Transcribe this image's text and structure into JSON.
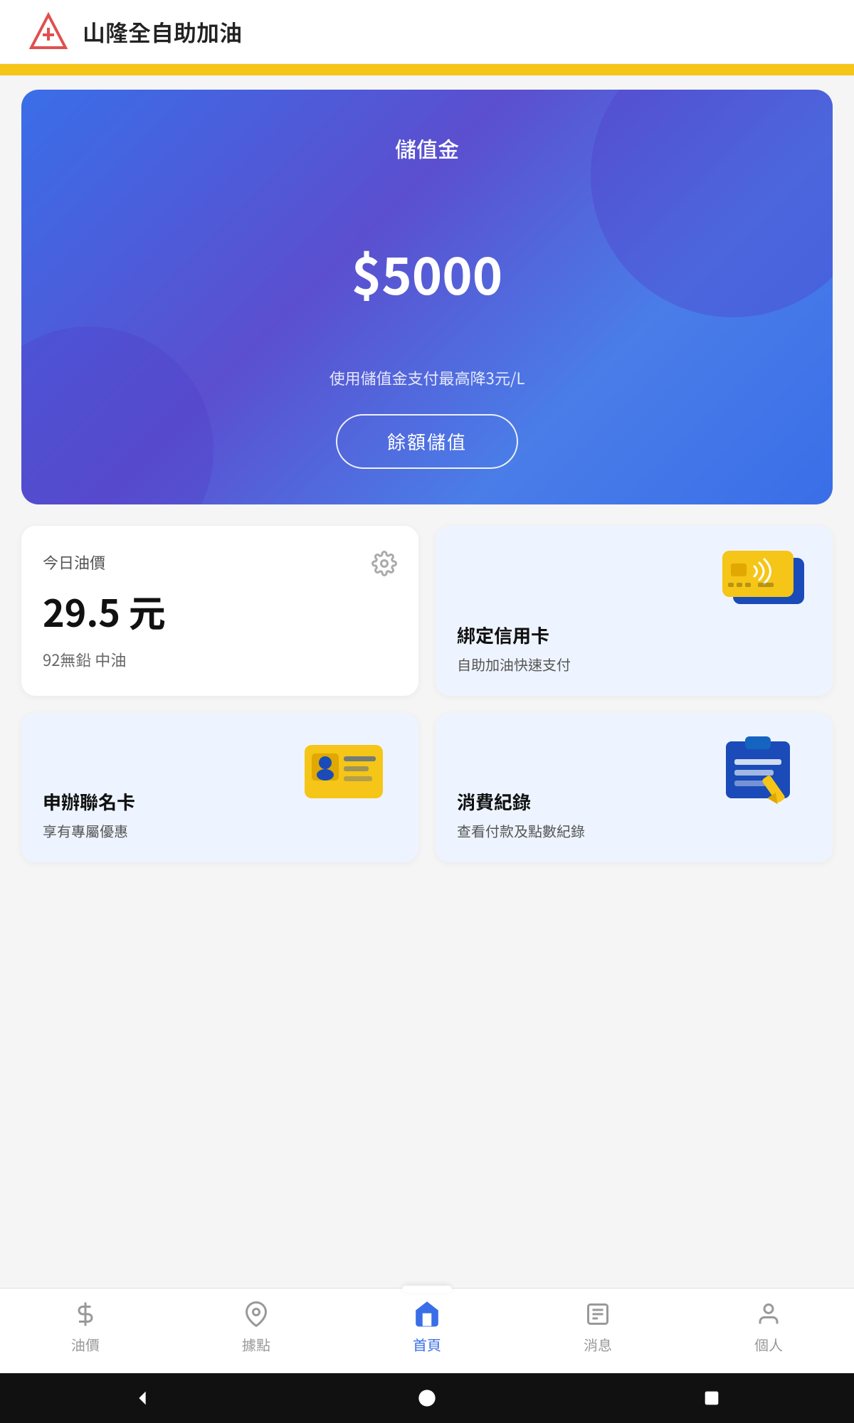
{
  "header": {
    "title": "山隆全自助加油"
  },
  "balance_card": {
    "label": "儲值金",
    "amount": "$5000",
    "hint": "使用儲值金支付最高降3元/L",
    "button_label": "餘額儲值"
  },
  "oil_price": {
    "section_label": "今日油價",
    "value": "29.5 元",
    "type": "92無鉛 中油"
  },
  "credit_card": {
    "title": "綁定信用卡",
    "subtitle": "自助加油快速支付"
  },
  "membership": {
    "title": "申辦聯名卡",
    "subtitle": "享有專屬優惠"
  },
  "record": {
    "title": "消費紀錄",
    "subtitle": "查看付款及點數紀錄"
  },
  "nav": {
    "items": [
      {
        "label": "油價",
        "icon": "dollar-icon",
        "active": false
      },
      {
        "label": "據點",
        "icon": "location-icon",
        "active": false
      },
      {
        "label": "首頁",
        "icon": "home-icon",
        "active": true
      },
      {
        "label": "消息",
        "icon": "news-icon",
        "active": false
      },
      {
        "label": "個人",
        "icon": "person-icon",
        "active": false
      }
    ]
  },
  "android": {
    "back": "◀",
    "home": "●",
    "recent": "■"
  }
}
